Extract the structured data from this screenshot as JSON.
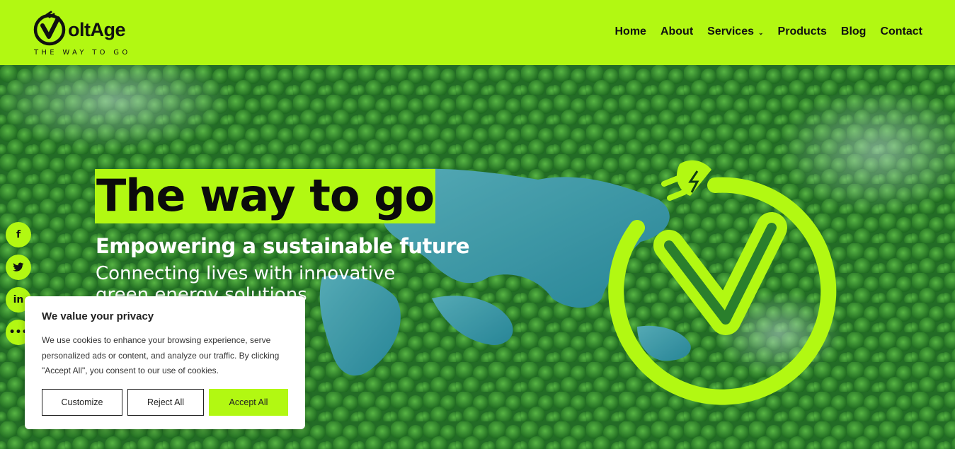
{
  "brand": {
    "name": "oltAge",
    "tagline": "THE WAY TO GO",
    "accent": "#b2f812"
  },
  "nav": {
    "items": [
      {
        "label": "Home"
      },
      {
        "label": "About"
      },
      {
        "label": "Services"
      },
      {
        "label": "Products"
      },
      {
        "label": "Blog"
      },
      {
        "label": "Contact"
      }
    ]
  },
  "social": {
    "icons": [
      "facebook-icon",
      "twitter-icon",
      "linkedin-icon",
      "more-icon"
    ],
    "glyphs": [
      "f",
      "🐦",
      "in",
      "•••"
    ]
  },
  "hero": {
    "headline": "The way to go",
    "subheading": "Empowering a sustainable future",
    "description": "Connecting lives with innovative green energy solutions"
  },
  "cookie": {
    "title": "We value your privacy",
    "text": "We use cookies to enhance your browsing experience, serve personalized ads or content, and analyze our traffic. By clicking \"Accept All\", you consent to our use of cookies.",
    "customize_label": "Customize",
    "reject_label": "Reject All",
    "accept_label": "Accept All"
  }
}
